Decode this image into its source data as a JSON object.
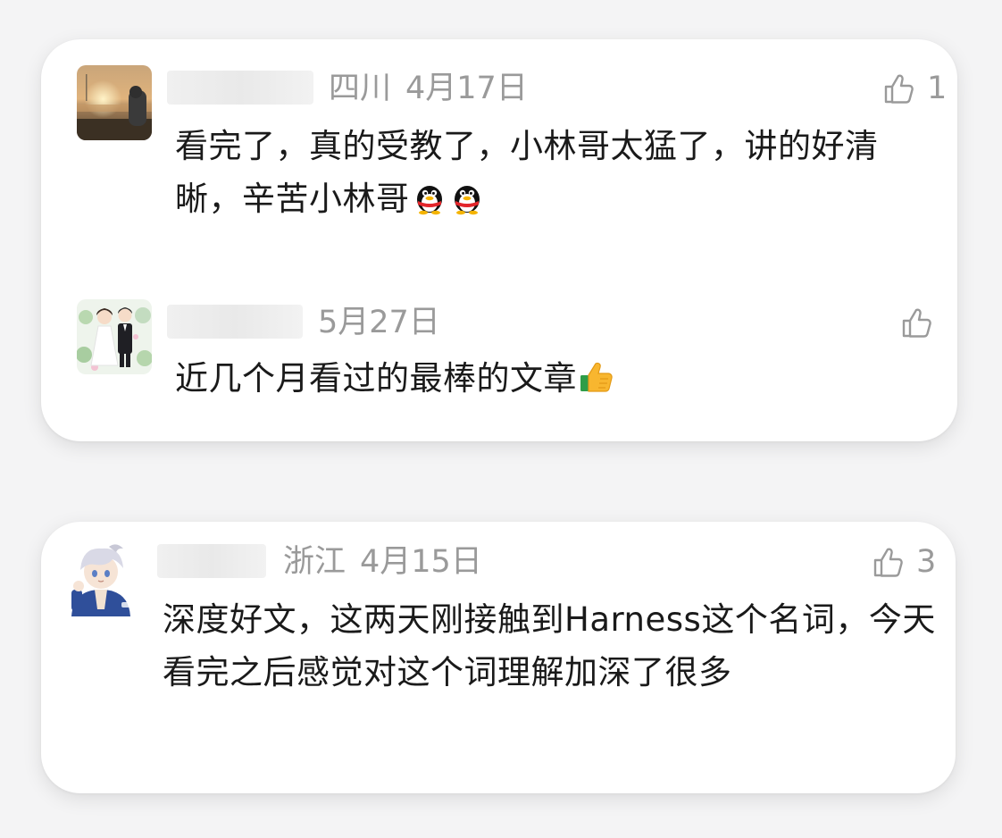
{
  "cards": [
    {
      "comments": [
        {
          "region": "四川",
          "date": "4月17日",
          "likes": "1",
          "text": "看完了，真的受教了，小林哥太猛了，讲的好清晰，辛苦小林哥",
          "emojis": [
            "qq-penguin-icon",
            "qq-penguin-icon"
          ],
          "avatar": "sunset-avatar"
        },
        {
          "region": "",
          "date": "5月27日",
          "likes": "",
          "text": "近几个月看过的最棒的文章",
          "emojis": [
            "thumbs-up-emoji"
          ],
          "avatar": "wedding-couple-avatar"
        }
      ]
    },
    {
      "comments": [
        {
          "region": "浙江",
          "date": "4月15日",
          "likes": "3",
          "text": "深度好文，这两天刚接触到Harness这个名词，今天看完之后感觉对这个词理解加深了很多",
          "emojis": [],
          "avatar": "anime-boy-avatar"
        }
      ]
    }
  ],
  "colors": {
    "background": "#f4f4f5",
    "card": "#ffffff",
    "meta_text": "#9a9a9a",
    "body_text": "#1a1a1a"
  }
}
